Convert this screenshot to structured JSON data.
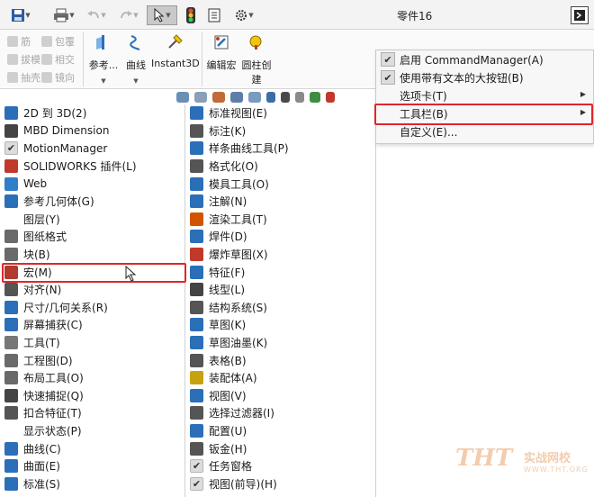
{
  "title_bar": {
    "document_title": "零件16"
  },
  "ribbon": {
    "disabled_items": [
      "筋",
      "包覆",
      "拔模",
      "相交",
      "抽壳",
      "镜向"
    ],
    "buttons": [
      {
        "label": "参考...",
        "icon": "reference-geometry-icon"
      },
      {
        "label": "曲线",
        "icon": "curves-icon"
      },
      {
        "label": "Instant3D",
        "icon": "instant3d-icon"
      },
      {
        "label": "编辑宏",
        "icon": "edit-macro-icon"
      },
      {
        "label": "圆柱创",
        "label2": "建",
        "icon": "cylinder-create-icon"
      }
    ]
  },
  "context_menu": {
    "items": [
      {
        "label": "启用 CommandManager(A)",
        "checked": true
      },
      {
        "label": "使用带有文本的大按钮(B)",
        "checked": true
      },
      {
        "label": "选项卡(T)",
        "checked": false,
        "submenu": true
      },
      {
        "label": "工具栏(B)",
        "checked": false,
        "submenu": true,
        "highlighted": true
      },
      {
        "label": "自定义(E)...",
        "checked": false
      }
    ]
  },
  "toolbars_left": [
    {
      "label": "2D 到 3D(2)",
      "icon": "2d-to-3d-icon",
      "color": "#2b6fb8",
      "checked": false
    },
    {
      "label": "MBD Dimension",
      "icon": "mbd-dimension-icon",
      "color": "#444444",
      "checked": false
    },
    {
      "label": "MotionManager",
      "icon": "checkmark-icon",
      "checked": true
    },
    {
      "label": "SOLIDWORKS 插件(L)",
      "icon": "addins-icon",
      "color": "#c0392b",
      "checked": false
    },
    {
      "label": "Web",
      "icon": "web-icon",
      "color": "#2f7fc8",
      "checked": false
    },
    {
      "label": "参考几何体(G)",
      "icon": "reference-geometry-icon",
      "color": "#2b6fb8",
      "checked": false
    },
    {
      "label": "图层(Y)",
      "icon": "none",
      "checked": false
    },
    {
      "label": "图纸格式",
      "icon": "sheet-format-icon",
      "color": "#6a6a6a",
      "checked": false
    },
    {
      "label": "块(B)",
      "icon": "block-icon",
      "color": "#6a6a6a",
      "checked": false
    },
    {
      "label": "宏(M)",
      "icon": "macro-icon",
      "color": "#b03a2e",
      "checked": false,
      "highlighted": true
    },
    {
      "label": "对齐(N)",
      "icon": "align-icon",
      "color": "#555555",
      "checked": false
    },
    {
      "label": "尺寸/几何关系(R)",
      "icon": "dimensions-relations-icon",
      "color": "#2b6fb8",
      "checked": false
    },
    {
      "label": "屏幕捕获(C)",
      "icon": "screen-capture-icon",
      "color": "#2b6fb8",
      "checked": false
    },
    {
      "label": "工具(T)",
      "icon": "tools-icon",
      "color": "#777777",
      "checked": false
    },
    {
      "label": "工程图(D)",
      "icon": "drawing-icon",
      "color": "#6a6a6a",
      "checked": false
    },
    {
      "label": "布局工具(O)",
      "icon": "layout-tools-icon",
      "color": "#6a6a6a",
      "checked": false
    },
    {
      "label": "快速捕捉(Q)",
      "icon": "quick-snaps-icon",
      "color": "#444444",
      "checked": false
    },
    {
      "label": "扣合特征(T)",
      "icon": "fastening-features-icon",
      "color": "#555555",
      "checked": false
    },
    {
      "label": "显示状态(P)",
      "icon": "none",
      "checked": false
    },
    {
      "label": "曲线(C)",
      "icon": "curves-icon",
      "color": "#2b6fb8",
      "checked": false
    },
    {
      "label": "曲面(E)",
      "icon": "surfaces-icon",
      "color": "#2b6fb8",
      "checked": false
    },
    {
      "label": "标准(S)",
      "icon": "standard-icon",
      "color": "#2b6fb8",
      "checked": false
    }
  ],
  "toolbars_mid": [
    {
      "label": "标准视图(E)",
      "icon": "standard-views-icon",
      "color": "#2b6fb8",
      "checked": false
    },
    {
      "label": "标注(K)",
      "icon": "annotation-icon",
      "color": "#555555",
      "checked": false
    },
    {
      "label": "样条曲线工具(P)",
      "icon": "spline-tools-icon",
      "color": "#2b6fb8",
      "checked": false
    },
    {
      "label": "格式化(O)",
      "icon": "format-icon",
      "color": "#555555",
      "checked": false
    },
    {
      "label": "模具工具(O)",
      "icon": "mold-tools-icon",
      "color": "#2b6fb8",
      "checked": false
    },
    {
      "label": "注解(N)",
      "icon": "annotations-icon",
      "color": "#2b6fb8",
      "checked": false
    },
    {
      "label": "渲染工具(T)",
      "icon": "render-tools-icon",
      "color": "#d35400",
      "checked": false
    },
    {
      "label": "焊件(D)",
      "icon": "weldments-icon",
      "color": "#2b6fb8",
      "checked": false
    },
    {
      "label": "爆炸草图(X)",
      "icon": "explode-sketch-icon",
      "color": "#c0392b",
      "checked": false
    },
    {
      "label": "特征(F)",
      "icon": "features-icon",
      "color": "#2b6fb8",
      "checked": false
    },
    {
      "label": "线型(L)",
      "icon": "line-format-icon",
      "color": "#444444",
      "checked": false
    },
    {
      "label": "结构系统(S)",
      "icon": "structure-system-icon",
      "color": "#555555",
      "checked": false
    },
    {
      "label": "草图(K)",
      "icon": "sketch-icon",
      "color": "#2b6fb8",
      "checked": false
    },
    {
      "label": "草图油墨(K)",
      "icon": "sketch-ink-icon",
      "color": "#2b6fb8",
      "checked": false
    },
    {
      "label": "表格(B)",
      "icon": "table-icon",
      "color": "#555555",
      "checked": false
    },
    {
      "label": "装配体(A)",
      "icon": "assembly-icon",
      "color": "#c7a20f",
      "checked": false
    },
    {
      "label": "视图(V)",
      "icon": "view-icon",
      "color": "#2b6fb8",
      "checked": false
    },
    {
      "label": "选择过滤器(I)",
      "icon": "selection-filter-icon",
      "color": "#555555",
      "checked": false
    },
    {
      "label": "配置(U)",
      "icon": "configurations-icon",
      "color": "#2b6fb8",
      "checked": false
    },
    {
      "label": "钣金(H)",
      "icon": "sheet-metal-icon",
      "color": "#555555",
      "checked": false
    },
    {
      "label": "任务窗格",
      "icon": "checkmark-icon",
      "checked": true
    },
    {
      "label": "视图(前导)(H)",
      "icon": "checkmark-icon",
      "checked": true
    }
  ],
  "watermark": {
    "big": "THT",
    "cn": "实战网校",
    "en": "WWW.THT.ORG"
  },
  "colors": {
    "highlight_box": "#e0262b",
    "accent": "#2b6fb8"
  }
}
